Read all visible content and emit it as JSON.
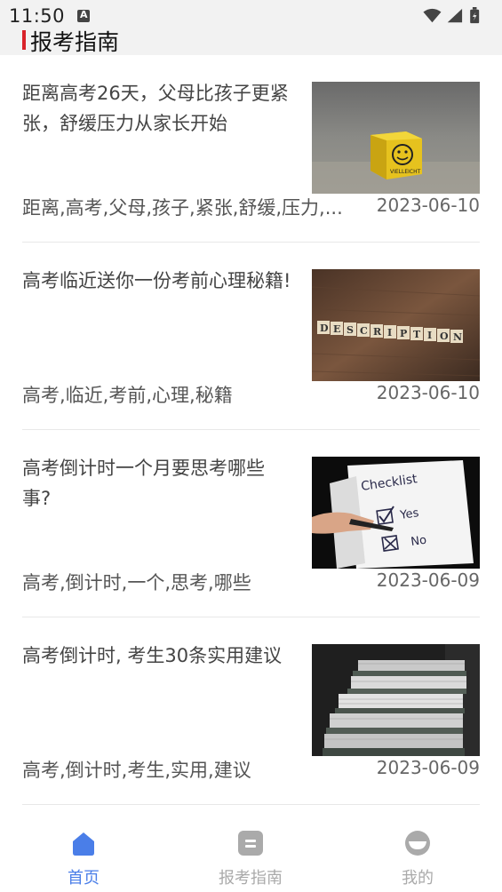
{
  "status": {
    "time": "11:50",
    "icons": [
      "a-notification-icon",
      "wifi-icon",
      "signal-icon",
      "battery-icon"
    ]
  },
  "header": {
    "title": "报考指南",
    "accent_color": "#d9232a"
  },
  "articles": [
    {
      "title": "距离高考26天，父母比孩子更紧张，舒缓压力从家长开始",
      "tags": "距离,高考,父母,孩子,紧张,舒缓,压力,...",
      "date": "2023-06-10",
      "image": "yellow-dice-photo"
    },
    {
      "title": "高考临近送你一份考前心理秘籍!",
      "tags": "高考,临近,考前,心理,秘籍",
      "date": "2023-06-10",
      "image": "description-letter-tiles-photo"
    },
    {
      "title": "高考倒计时一个月要思考哪些事?",
      "tags": "高考,倒计时,一个,思考,哪些",
      "date": "2023-06-09",
      "image": "checklist-photo"
    },
    {
      "title": "高考倒计时, 考生30条实用建议",
      "tags": "高考,倒计时,考生,实用,建议",
      "date": "2023-06-09",
      "image": "stacked-binders-photo"
    }
  ],
  "tabbar": {
    "active_color": "#4a7ee8",
    "inactive_color": "#aaaaaa",
    "tabs": [
      {
        "label": "首页",
        "icon": "home-icon",
        "active": true
      },
      {
        "label": "报考指南",
        "icon": "guide-icon",
        "active": false
      },
      {
        "label": "我的",
        "icon": "profile-icon",
        "active": false
      }
    ]
  }
}
